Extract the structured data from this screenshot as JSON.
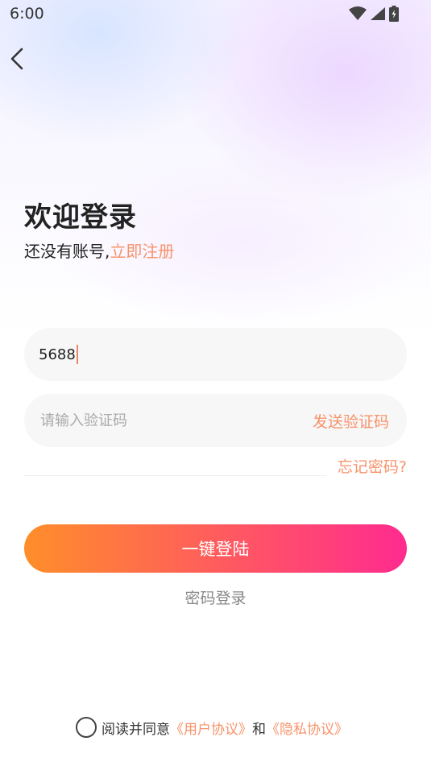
{
  "status_bar": {
    "time": "6:00"
  },
  "header": {
    "title": "欢迎登录"
  },
  "register": {
    "prompt": "还没有账号,",
    "link": "立即注册"
  },
  "phone_field": {
    "value": "5688"
  },
  "code_field": {
    "placeholder": "请输入验证码",
    "send_label": "发送验证码"
  },
  "forgot_label": "忘记密码?",
  "login_button": "一键登陆",
  "password_login": "密码登录",
  "agreement": {
    "text": "阅读并同意",
    "user_agreement": "《用户协议》",
    "and": "和",
    "privacy_policy": "《隐私协议》"
  },
  "colors": {
    "accent": "#f7936b",
    "button_start": "#ff8e2a",
    "button_end": "#ff2b8f"
  },
  "icons": [
    "wifi-icon",
    "signal-icon",
    "battery-icon",
    "back-arrow-icon",
    "radio-unchecked-icon"
  ]
}
